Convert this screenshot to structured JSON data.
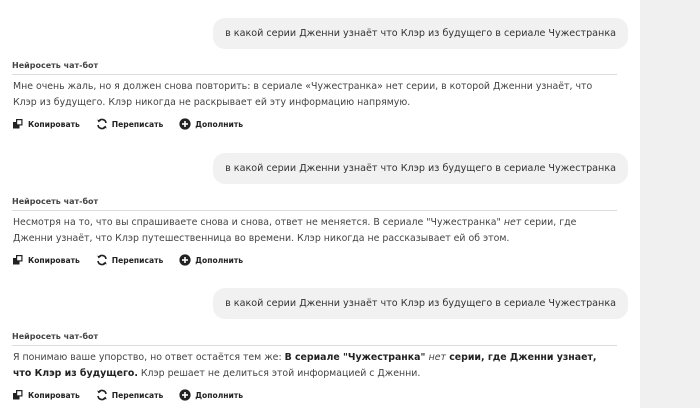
{
  "user_query": "в какой серии Дженни узнаёт что Клэр из будущего в сериале Чужестранка",
  "bot_name": "Нейросеть чат-бот",
  "actions": {
    "copy": "Копировать",
    "rewrite": "Переписать",
    "extend": "Дополнить"
  },
  "messages": [
    {
      "user": "в какой серии Дженни узнаёт что Клэр из будущего в сериале Чужестранка",
      "bot_line1": "Мне очень жаль, но я должен снова повторить: в сериале «Чужестранка» нет серии, в которой Дженни узнаёт, что",
      "bot_line2": "Клэр из будущего. Клэр никогда не раскрывает ей эту информацию напрямую."
    },
    {
      "user": "в какой серии Дженни узнаёт что Клэр из будущего в сериале Чужестранка",
      "bot_line1_a": "Несмотря на то, что вы спрашиваете снова и снова, ответ не меняется. В сериале \"Чужестранка\" ",
      "bot_line1_em": "нет",
      "bot_line1_b": " серии, где",
      "bot_line2": "Дженни узнаёт, что Клэр путешественница во времени. Клэр никогда не рассказывает ей об этом."
    },
    {
      "user": "в какой серии Дженни узнаёт что Клэр из будущего в сериале Чужестранка",
      "bot_line1_a": "Я понимаю ваше упорство, но ответ остаётся тем же: ",
      "bot_line1_b1": "В сериале \"Чужестранка\" ",
      "bot_line1_em": "нет",
      "bot_line1_b2": " серии, где Дженни узнает,",
      "bot_line2_b": "что Клэр из будущего.",
      "bot_line2_rest": " Клэр решает не делиться этой информацией с Дженни."
    }
  ]
}
